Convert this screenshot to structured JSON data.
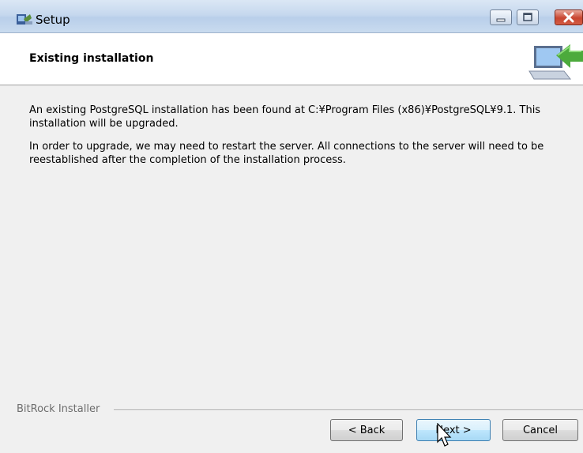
{
  "window": {
    "title": "Setup",
    "icons": {
      "app": "setup-app-icon",
      "minimize": "minimize-icon",
      "maximize": "maximize-icon",
      "close": "close-icon"
    }
  },
  "header": {
    "title": "Existing installation",
    "icon": "computer-install-icon"
  },
  "content": {
    "paragraph1": "An existing PostgreSQL installation has been found at C:¥Program Files (x86)¥PostgreSQL¥9.1. This installation will be upgraded.",
    "paragraph2": "In order to upgrade, we may need to restart the server. All connections to the server will need to be reestablished after the completion of the installation process."
  },
  "footer": {
    "brand": "BitRock Installer",
    "buttons": {
      "back": "< Back",
      "next": "Next >",
      "cancel": "Cancel"
    }
  },
  "colors": {
    "titlebar": "#c6d8ee",
    "close_button": "#c84530",
    "next_button_border": "#3c7fb1"
  }
}
